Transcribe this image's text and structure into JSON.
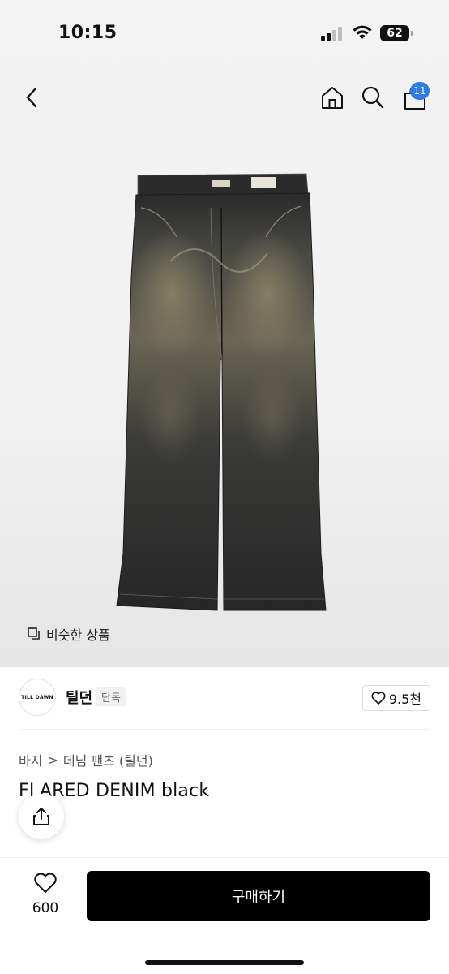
{
  "status": {
    "time": "10:15",
    "battery": "62"
  },
  "header": {
    "cart_count": "11"
  },
  "similar_button": {
    "label": "비슷한 상품"
  },
  "brand": {
    "logo_text": "TILL DAWN",
    "name": "틸던",
    "tag": "단독",
    "likes": "9.5천"
  },
  "breadcrumb": {
    "category": "바지",
    "separator": ">",
    "subcategory": "데님 팬츠 (틸던)"
  },
  "product": {
    "title": "FLARED DENIM black"
  },
  "bottom_bar": {
    "wish_count": "600",
    "buy_label": "구매하기"
  },
  "icons": [
    "chevron-left-icon",
    "home-icon",
    "search-icon",
    "bag-icon",
    "similar-icon",
    "heart-icon",
    "share-icon"
  ]
}
